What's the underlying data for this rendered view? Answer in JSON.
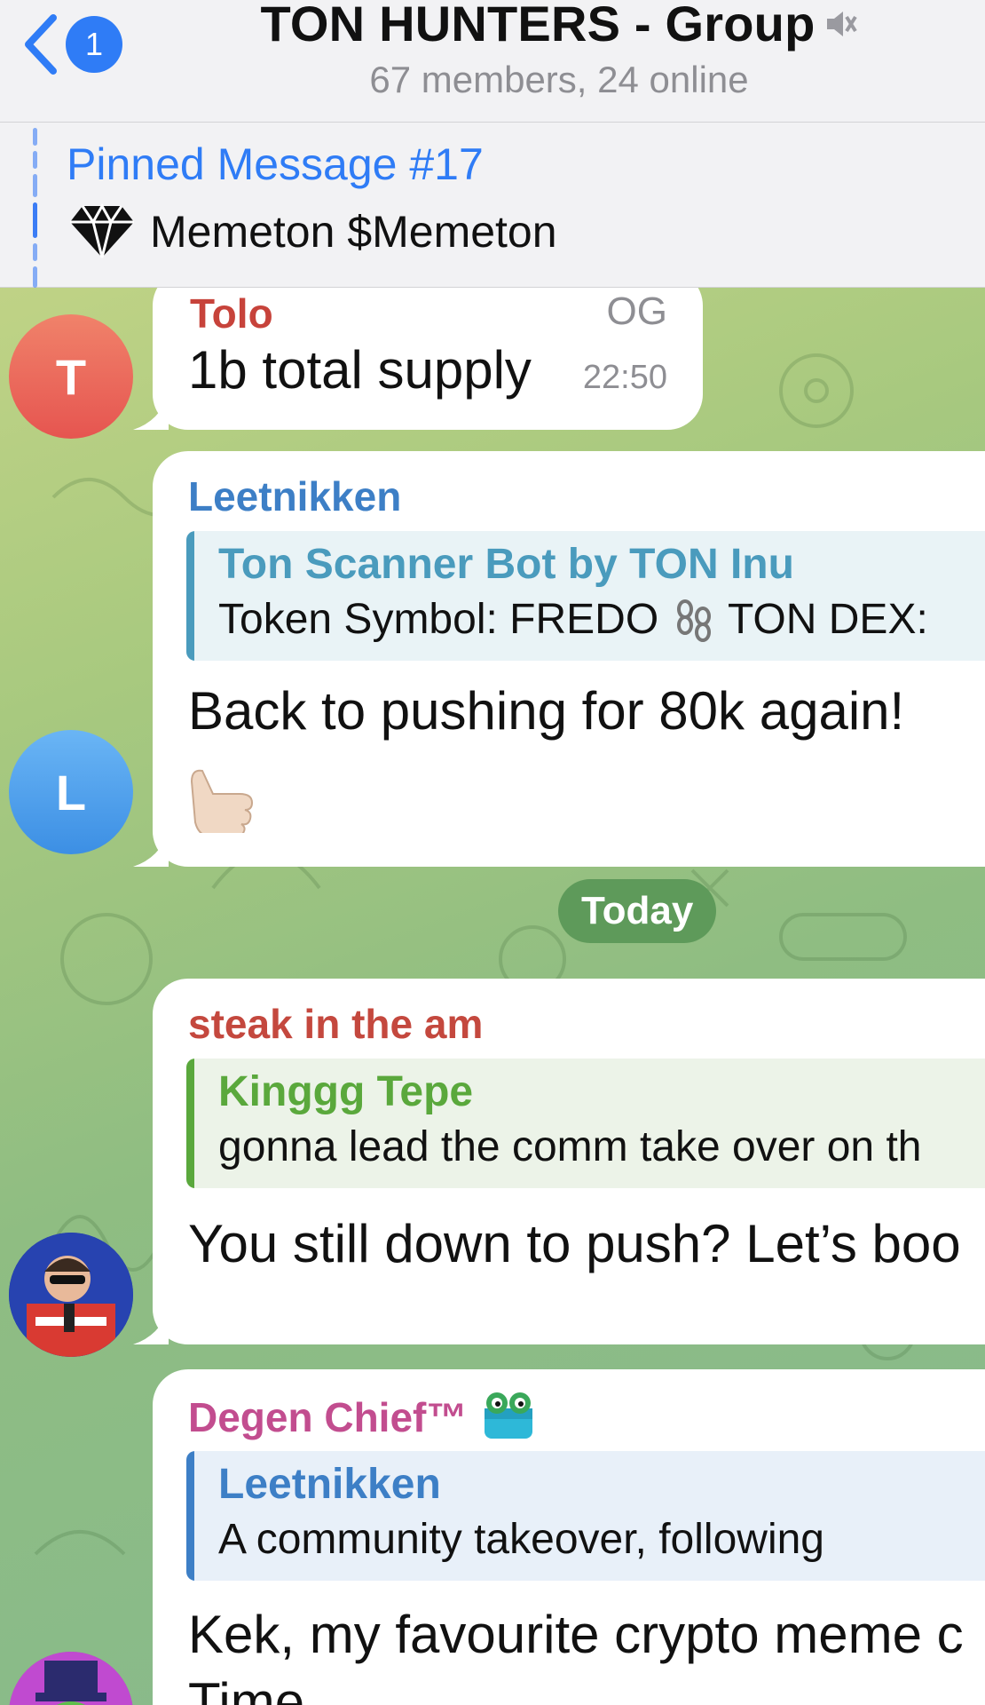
{
  "header": {
    "unread_count": "1",
    "title": "TON HUNTERS - Group",
    "subtitle": "67 members, 24 online"
  },
  "pinned": {
    "title": "Pinned Message #17",
    "text": "Memeton $Memeton"
  },
  "messages": [
    {
      "sender": "Tolo",
      "sender_color": "#c7433b",
      "avatar_letter": "T",
      "badge": "OG",
      "text": "1b total supply",
      "time": "22:50"
    },
    {
      "sender": "Leetnikken",
      "sender_color": "#3d7fc6",
      "avatar_letter": "L",
      "quote_name": "Ton Scanner Bot by TON Inu",
      "quote_text": "Token Symbol: FREDO",
      "quote_text_tail": "TON DEX:",
      "text": "Back to pushing for 80k again!"
    },
    {
      "sender": "steak in the am",
      "sender_color": "#c4483e",
      "quote_name": "Kinggg Tepe",
      "quote_text": "gonna lead the comm take over on th",
      "text": "You still down to push? Let’s boo"
    },
    {
      "sender": "Degen Chief™",
      "sender_color": "#c24d8f",
      "quote_name": "Leetnikken",
      "quote_text": "A community takeover, following",
      "text": "Kek, my favourite crypto meme c",
      "text2": "Time"
    }
  ],
  "date_separator": "Today",
  "colors": {
    "accent": "#2f7cf6",
    "bot_quote": "#4a9bbd",
    "green_quote": "#5aa83c"
  }
}
